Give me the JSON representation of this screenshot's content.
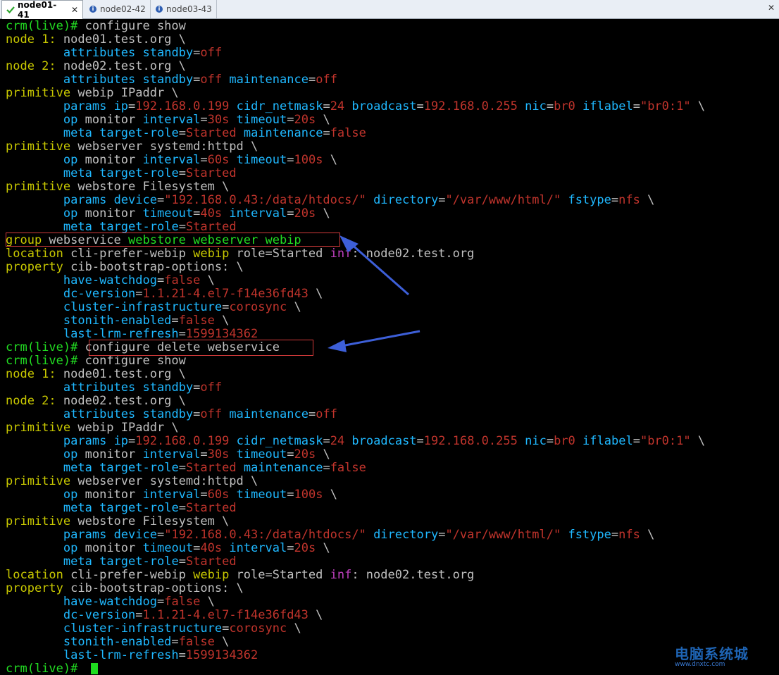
{
  "tabs": [
    {
      "label": "node01-41",
      "status": "check-icon",
      "active": true
    },
    {
      "label": "node02-42",
      "status": "info-icon",
      "active": false
    },
    {
      "label": "node03-43",
      "status": "info-icon",
      "active": false
    }
  ],
  "colors": {
    "background": "#000000",
    "default": "#c0c0c0",
    "prompt": "#22dd22",
    "keyword": "#c8c800",
    "attr": "#1fb8ff",
    "value": "#c0342c",
    "magenta": "#c040c0",
    "highlight_border": "#d23a3a",
    "arrow": "#3d5fd8"
  },
  "terminal": {
    "lines": [
      [
        [
          "crm(live)#",
          "p"
        ],
        [
          " configure show",
          "d"
        ]
      ],
      [
        [
          "node 1:",
          "k"
        ],
        [
          " node01.test.org \\",
          "d"
        ]
      ],
      [
        [
          "        ",
          "d"
        ],
        [
          "attributes",
          "a"
        ],
        [
          " ",
          "d"
        ],
        [
          "standby",
          "a"
        ],
        [
          "=",
          "d"
        ],
        [
          "off",
          "v"
        ]
      ],
      [
        [
          "node 2:",
          "k"
        ],
        [
          " node02.test.org \\",
          "d"
        ]
      ],
      [
        [
          "        ",
          "d"
        ],
        [
          "attributes",
          "a"
        ],
        [
          " ",
          "d"
        ],
        [
          "standby",
          "a"
        ],
        [
          "=",
          "d"
        ],
        [
          "off",
          "v"
        ],
        [
          " ",
          "d"
        ],
        [
          "maintenance",
          "a"
        ],
        [
          "=",
          "d"
        ],
        [
          "off",
          "v"
        ]
      ],
      [
        [
          "primitive",
          "k"
        ],
        [
          " webip IPaddr \\",
          "d"
        ]
      ],
      [
        [
          "        ",
          "d"
        ],
        [
          "params",
          "a"
        ],
        [
          " ",
          "d"
        ],
        [
          "ip",
          "a"
        ],
        [
          "=",
          "d"
        ],
        [
          "192.168.0.199",
          "v"
        ],
        [
          " ",
          "d"
        ],
        [
          "cidr_netmask",
          "a"
        ],
        [
          "=",
          "d"
        ],
        [
          "24",
          "v"
        ],
        [
          " ",
          "d"
        ],
        [
          "broadcast",
          "a"
        ],
        [
          "=",
          "d"
        ],
        [
          "192.168.0.255",
          "v"
        ],
        [
          " ",
          "d"
        ],
        [
          "nic",
          "a"
        ],
        [
          "=",
          "d"
        ],
        [
          "br0",
          "v"
        ],
        [
          " ",
          "d"
        ],
        [
          "iflabel",
          "a"
        ],
        [
          "=",
          "d"
        ],
        [
          "\"br0:1\"",
          "v"
        ],
        [
          " \\",
          "d"
        ]
      ],
      [
        [
          "        ",
          "d"
        ],
        [
          "op",
          "a"
        ],
        [
          " monitor ",
          "d"
        ],
        [
          "interval",
          "a"
        ],
        [
          "=",
          "d"
        ],
        [
          "30s",
          "v"
        ],
        [
          " ",
          "d"
        ],
        [
          "timeout",
          "a"
        ],
        [
          "=",
          "d"
        ],
        [
          "20s",
          "v"
        ],
        [
          " \\",
          "d"
        ]
      ],
      [
        [
          "        ",
          "d"
        ],
        [
          "meta",
          "a"
        ],
        [
          " ",
          "d"
        ],
        [
          "target-role",
          "a"
        ],
        [
          "=",
          "d"
        ],
        [
          "Started",
          "v"
        ],
        [
          " ",
          "d"
        ],
        [
          "maintenance",
          "a"
        ],
        [
          "=",
          "d"
        ],
        [
          "false",
          "v"
        ]
      ],
      [
        [
          "primitive",
          "k"
        ],
        [
          " webserver systemd:httpd \\",
          "d"
        ]
      ],
      [
        [
          "        ",
          "d"
        ],
        [
          "op",
          "a"
        ],
        [
          " monitor ",
          "d"
        ],
        [
          "interval",
          "a"
        ],
        [
          "=",
          "d"
        ],
        [
          "60s",
          "v"
        ],
        [
          " ",
          "d"
        ],
        [
          "timeout",
          "a"
        ],
        [
          "=",
          "d"
        ],
        [
          "100s",
          "v"
        ],
        [
          " \\",
          "d"
        ]
      ],
      [
        [
          "        ",
          "d"
        ],
        [
          "meta",
          "a"
        ],
        [
          " ",
          "d"
        ],
        [
          "target-role",
          "a"
        ],
        [
          "=",
          "d"
        ],
        [
          "Started",
          "v"
        ]
      ],
      [
        [
          "primitive",
          "k"
        ],
        [
          " webstore Filesystem \\",
          "d"
        ]
      ],
      [
        [
          "        ",
          "d"
        ],
        [
          "params",
          "a"
        ],
        [
          " ",
          "d"
        ],
        [
          "device",
          "a"
        ],
        [
          "=",
          "d"
        ],
        [
          "\"192.168.0.43:/data/htdocs/\"",
          "v"
        ],
        [
          " ",
          "d"
        ],
        [
          "directory",
          "a"
        ],
        [
          "=",
          "d"
        ],
        [
          "\"/var/www/html/\"",
          "v"
        ],
        [
          " ",
          "d"
        ],
        [
          "fstype",
          "a"
        ],
        [
          "=",
          "d"
        ],
        [
          "nfs",
          "v"
        ],
        [
          " \\",
          "d"
        ]
      ],
      [
        [
          "        ",
          "d"
        ],
        [
          "op",
          "a"
        ],
        [
          " monitor ",
          "d"
        ],
        [
          "timeout",
          "a"
        ],
        [
          "=",
          "d"
        ],
        [
          "40s",
          "v"
        ],
        [
          " ",
          "d"
        ],
        [
          "interval",
          "a"
        ],
        [
          "=",
          "d"
        ],
        [
          "20s",
          "v"
        ],
        [
          " \\",
          "d"
        ]
      ],
      [
        [
          "        ",
          "d"
        ],
        [
          "meta",
          "a"
        ],
        [
          " ",
          "d"
        ],
        [
          "target-role",
          "a"
        ],
        [
          "=",
          "d"
        ],
        [
          "Started",
          "v"
        ]
      ],
      [
        [
          "group",
          "k"
        ],
        [
          " webservice ",
          "d"
        ],
        [
          "webstore webserver webip",
          "p"
        ]
      ],
      [
        [
          "location",
          "k"
        ],
        [
          " cli-prefer-webip ",
          "d"
        ],
        [
          "webip",
          "k"
        ],
        [
          " role=Started ",
          "d"
        ],
        [
          "inf",
          "m"
        ],
        [
          ": node02.test.org",
          "d"
        ]
      ],
      [
        [
          "property",
          "k"
        ],
        [
          " cib-bootstrap-options: \\",
          "d"
        ]
      ],
      [
        [
          "        ",
          "d"
        ],
        [
          "have-watchdog",
          "a"
        ],
        [
          "=",
          "d"
        ],
        [
          "false",
          "v"
        ],
        [
          " \\",
          "d"
        ]
      ],
      [
        [
          "        ",
          "d"
        ],
        [
          "dc-version",
          "a"
        ],
        [
          "=",
          "d"
        ],
        [
          "1.1.21-4.el7-f14e36fd43",
          "v"
        ],
        [
          " \\",
          "d"
        ]
      ],
      [
        [
          "        ",
          "d"
        ],
        [
          "cluster-infrastructure",
          "a"
        ],
        [
          "=",
          "d"
        ],
        [
          "corosync",
          "v"
        ],
        [
          " \\",
          "d"
        ]
      ],
      [
        [
          "        ",
          "d"
        ],
        [
          "stonith-enabled",
          "a"
        ],
        [
          "=",
          "d"
        ],
        [
          "false",
          "v"
        ],
        [
          " \\",
          "d"
        ]
      ],
      [
        [
          "        ",
          "d"
        ],
        [
          "last-lrm-refresh",
          "a"
        ],
        [
          "=",
          "d"
        ],
        [
          "1599134362",
          "v"
        ]
      ],
      [
        [
          "crm(live)#",
          "p"
        ],
        [
          " configure delete webservice",
          "d"
        ]
      ],
      [
        [
          "crm(live)#",
          "p"
        ],
        [
          " configure show",
          "d"
        ]
      ],
      [
        [
          "node 1:",
          "k"
        ],
        [
          " node01.test.org \\",
          "d"
        ]
      ],
      [
        [
          "        ",
          "d"
        ],
        [
          "attributes",
          "a"
        ],
        [
          " ",
          "d"
        ],
        [
          "standby",
          "a"
        ],
        [
          "=",
          "d"
        ],
        [
          "off",
          "v"
        ]
      ],
      [
        [
          "node 2:",
          "k"
        ],
        [
          " node02.test.org \\",
          "d"
        ]
      ],
      [
        [
          "        ",
          "d"
        ],
        [
          "attributes",
          "a"
        ],
        [
          " ",
          "d"
        ],
        [
          "standby",
          "a"
        ],
        [
          "=",
          "d"
        ],
        [
          "off",
          "v"
        ],
        [
          " ",
          "d"
        ],
        [
          "maintenance",
          "a"
        ],
        [
          "=",
          "d"
        ],
        [
          "off",
          "v"
        ]
      ],
      [
        [
          "primitive",
          "k"
        ],
        [
          " webip IPaddr \\",
          "d"
        ]
      ],
      [
        [
          "        ",
          "d"
        ],
        [
          "params",
          "a"
        ],
        [
          " ",
          "d"
        ],
        [
          "ip",
          "a"
        ],
        [
          "=",
          "d"
        ],
        [
          "192.168.0.199",
          "v"
        ],
        [
          " ",
          "d"
        ],
        [
          "cidr_netmask",
          "a"
        ],
        [
          "=",
          "d"
        ],
        [
          "24",
          "v"
        ],
        [
          " ",
          "d"
        ],
        [
          "broadcast",
          "a"
        ],
        [
          "=",
          "d"
        ],
        [
          "192.168.0.255",
          "v"
        ],
        [
          " ",
          "d"
        ],
        [
          "nic",
          "a"
        ],
        [
          "=",
          "d"
        ],
        [
          "br0",
          "v"
        ],
        [
          " ",
          "d"
        ],
        [
          "iflabel",
          "a"
        ],
        [
          "=",
          "d"
        ],
        [
          "\"br0:1\"",
          "v"
        ],
        [
          " \\",
          "d"
        ]
      ],
      [
        [
          "        ",
          "d"
        ],
        [
          "op",
          "a"
        ],
        [
          " monitor ",
          "d"
        ],
        [
          "interval",
          "a"
        ],
        [
          "=",
          "d"
        ],
        [
          "30s",
          "v"
        ],
        [
          " ",
          "d"
        ],
        [
          "timeout",
          "a"
        ],
        [
          "=",
          "d"
        ],
        [
          "20s",
          "v"
        ],
        [
          " \\",
          "d"
        ]
      ],
      [
        [
          "        ",
          "d"
        ],
        [
          "meta",
          "a"
        ],
        [
          " ",
          "d"
        ],
        [
          "target-role",
          "a"
        ],
        [
          "=",
          "d"
        ],
        [
          "Started",
          "v"
        ],
        [
          " ",
          "d"
        ],
        [
          "maintenance",
          "a"
        ],
        [
          "=",
          "d"
        ],
        [
          "false",
          "v"
        ]
      ],
      [
        [
          "primitive",
          "k"
        ],
        [
          " webserver systemd:httpd \\",
          "d"
        ]
      ],
      [
        [
          "        ",
          "d"
        ],
        [
          "op",
          "a"
        ],
        [
          " monitor ",
          "d"
        ],
        [
          "interval",
          "a"
        ],
        [
          "=",
          "d"
        ],
        [
          "60s",
          "v"
        ],
        [
          " ",
          "d"
        ],
        [
          "timeout",
          "a"
        ],
        [
          "=",
          "d"
        ],
        [
          "100s",
          "v"
        ],
        [
          " \\",
          "d"
        ]
      ],
      [
        [
          "        ",
          "d"
        ],
        [
          "meta",
          "a"
        ],
        [
          " ",
          "d"
        ],
        [
          "target-role",
          "a"
        ],
        [
          "=",
          "d"
        ],
        [
          "Started",
          "v"
        ]
      ],
      [
        [
          "primitive",
          "k"
        ],
        [
          " webstore Filesystem \\",
          "d"
        ]
      ],
      [
        [
          "        ",
          "d"
        ],
        [
          "params",
          "a"
        ],
        [
          " ",
          "d"
        ],
        [
          "device",
          "a"
        ],
        [
          "=",
          "d"
        ],
        [
          "\"192.168.0.43:/data/htdocs/\"",
          "v"
        ],
        [
          " ",
          "d"
        ],
        [
          "directory",
          "a"
        ],
        [
          "=",
          "d"
        ],
        [
          "\"/var/www/html/\"",
          "v"
        ],
        [
          " ",
          "d"
        ],
        [
          "fstype",
          "a"
        ],
        [
          "=",
          "d"
        ],
        [
          "nfs",
          "v"
        ],
        [
          " \\",
          "d"
        ]
      ],
      [
        [
          "        ",
          "d"
        ],
        [
          "op",
          "a"
        ],
        [
          " monitor ",
          "d"
        ],
        [
          "timeout",
          "a"
        ],
        [
          "=",
          "d"
        ],
        [
          "40s",
          "v"
        ],
        [
          " ",
          "d"
        ],
        [
          "interval",
          "a"
        ],
        [
          "=",
          "d"
        ],
        [
          "20s",
          "v"
        ],
        [
          " \\",
          "d"
        ]
      ],
      [
        [
          "        ",
          "d"
        ],
        [
          "meta",
          "a"
        ],
        [
          " ",
          "d"
        ],
        [
          "target-role",
          "a"
        ],
        [
          "=",
          "d"
        ],
        [
          "Started",
          "v"
        ]
      ],
      [
        [
          "location",
          "k"
        ],
        [
          " cli-prefer-webip ",
          "d"
        ],
        [
          "webip",
          "k"
        ],
        [
          " role=Started ",
          "d"
        ],
        [
          "inf",
          "m"
        ],
        [
          ": node02.test.org",
          "d"
        ]
      ],
      [
        [
          "property",
          "k"
        ],
        [
          " cib-bootstrap-options: \\",
          "d"
        ]
      ],
      [
        [
          "        ",
          "d"
        ],
        [
          "have-watchdog",
          "a"
        ],
        [
          "=",
          "d"
        ],
        [
          "false",
          "v"
        ],
        [
          " \\",
          "d"
        ]
      ],
      [
        [
          "        ",
          "d"
        ],
        [
          "dc-version",
          "a"
        ],
        [
          "=",
          "d"
        ],
        [
          "1.1.21-4.el7-f14e36fd43",
          "v"
        ],
        [
          " \\",
          "d"
        ]
      ],
      [
        [
          "        ",
          "d"
        ],
        [
          "cluster-infrastructure",
          "a"
        ],
        [
          "=",
          "d"
        ],
        [
          "corosync",
          "v"
        ],
        [
          " \\",
          "d"
        ]
      ],
      [
        [
          "        ",
          "d"
        ],
        [
          "stonith-enabled",
          "a"
        ],
        [
          "=",
          "d"
        ],
        [
          "false",
          "v"
        ],
        [
          " \\",
          "d"
        ]
      ],
      [
        [
          "        ",
          "d"
        ],
        [
          "last-lrm-refresh",
          "a"
        ],
        [
          "=",
          "d"
        ],
        [
          "1599134362",
          "v"
        ]
      ],
      [
        [
          "crm(live)#",
          "p"
        ],
        [
          " ",
          "d"
        ]
      ]
    ]
  },
  "watermark": {
    "main": "电脑系统城",
    "sub": "www.dnxtc.com"
  }
}
